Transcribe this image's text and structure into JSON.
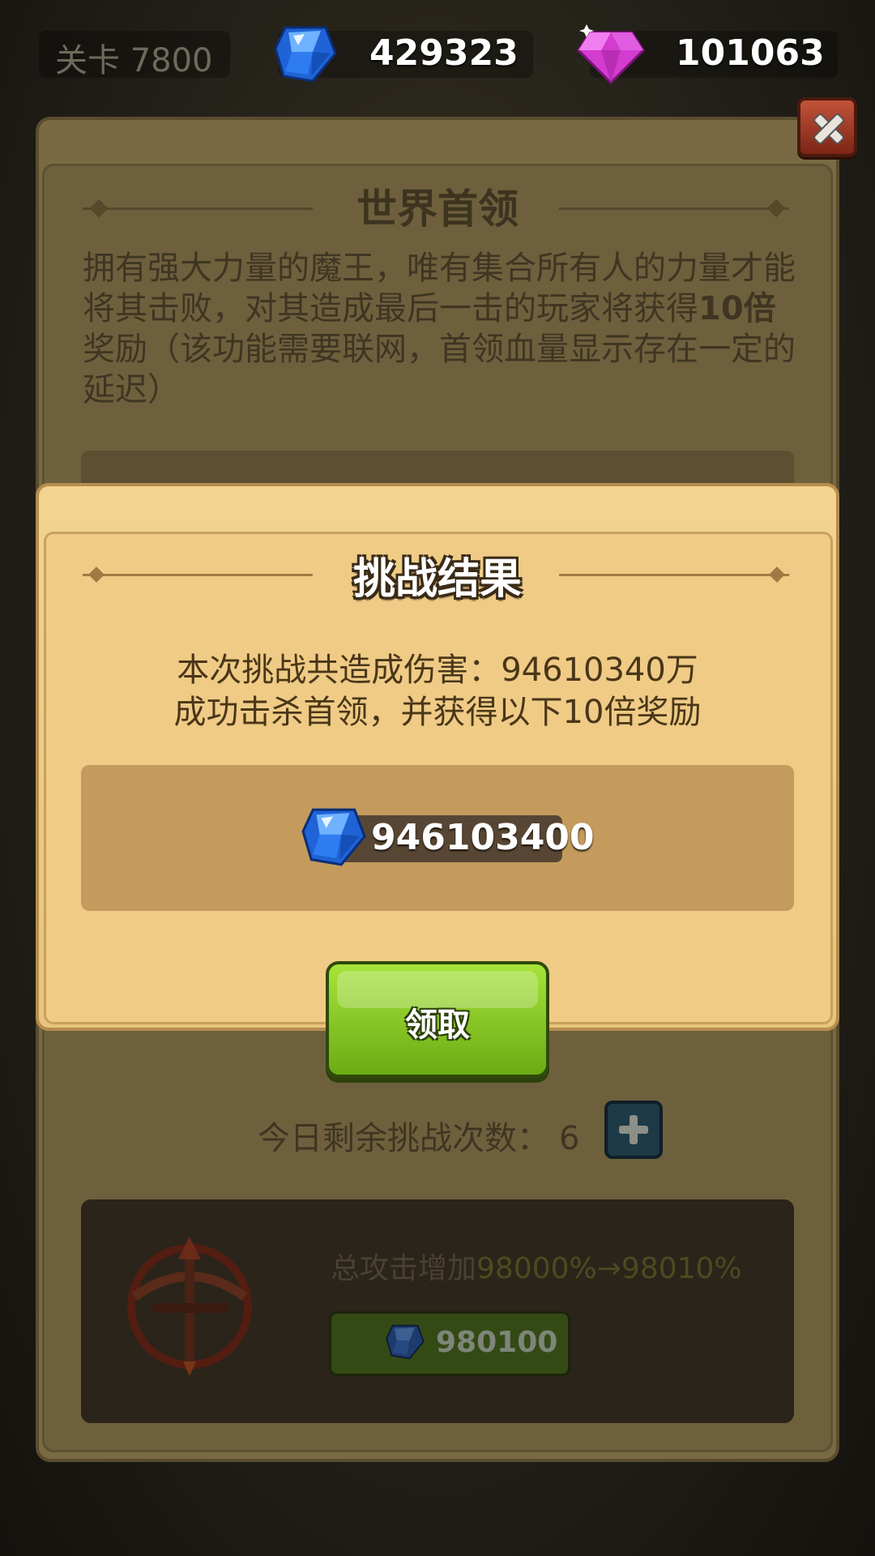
{
  "topbar": {
    "level_label": "关卡 7800",
    "sapphire_amount": "429323",
    "gem_amount": "101063"
  },
  "boss_panel": {
    "title": "世界首领",
    "desc_part1": "拥有强大力量的魔王，唯有集合所有人的力量才能将其击败，对其造成最后一击的玩家将获得",
    "desc_bold": "10倍",
    "desc_part2": "奖励（该功能需要联网，首领血量显示存在一定的延迟）",
    "remaining_label": "今日剩余挑战次数：",
    "remaining_count": "6",
    "upgrade_text": "总攻击增加",
    "upgrade_values": "98000%→98010%",
    "upgrade_cost": "980100"
  },
  "popup": {
    "title": "挑战结果",
    "damage_line": "本次挑战共造成伤害：94610340万",
    "kill_line": "成功击杀首领，并获得以下10倍奖励",
    "reward_amount": "946103400",
    "claim_label": "领取"
  },
  "icons": {
    "sapphire": "sapphire-gem-icon",
    "pink_gem": "pink-diamond-icon",
    "close": "close-icon",
    "plus": "plus-icon",
    "weapon": "crossbow-icon"
  },
  "colors": {
    "claim_button": "#8bc926",
    "popup_bg": "#efcb86",
    "close_button": "#a33b25"
  }
}
